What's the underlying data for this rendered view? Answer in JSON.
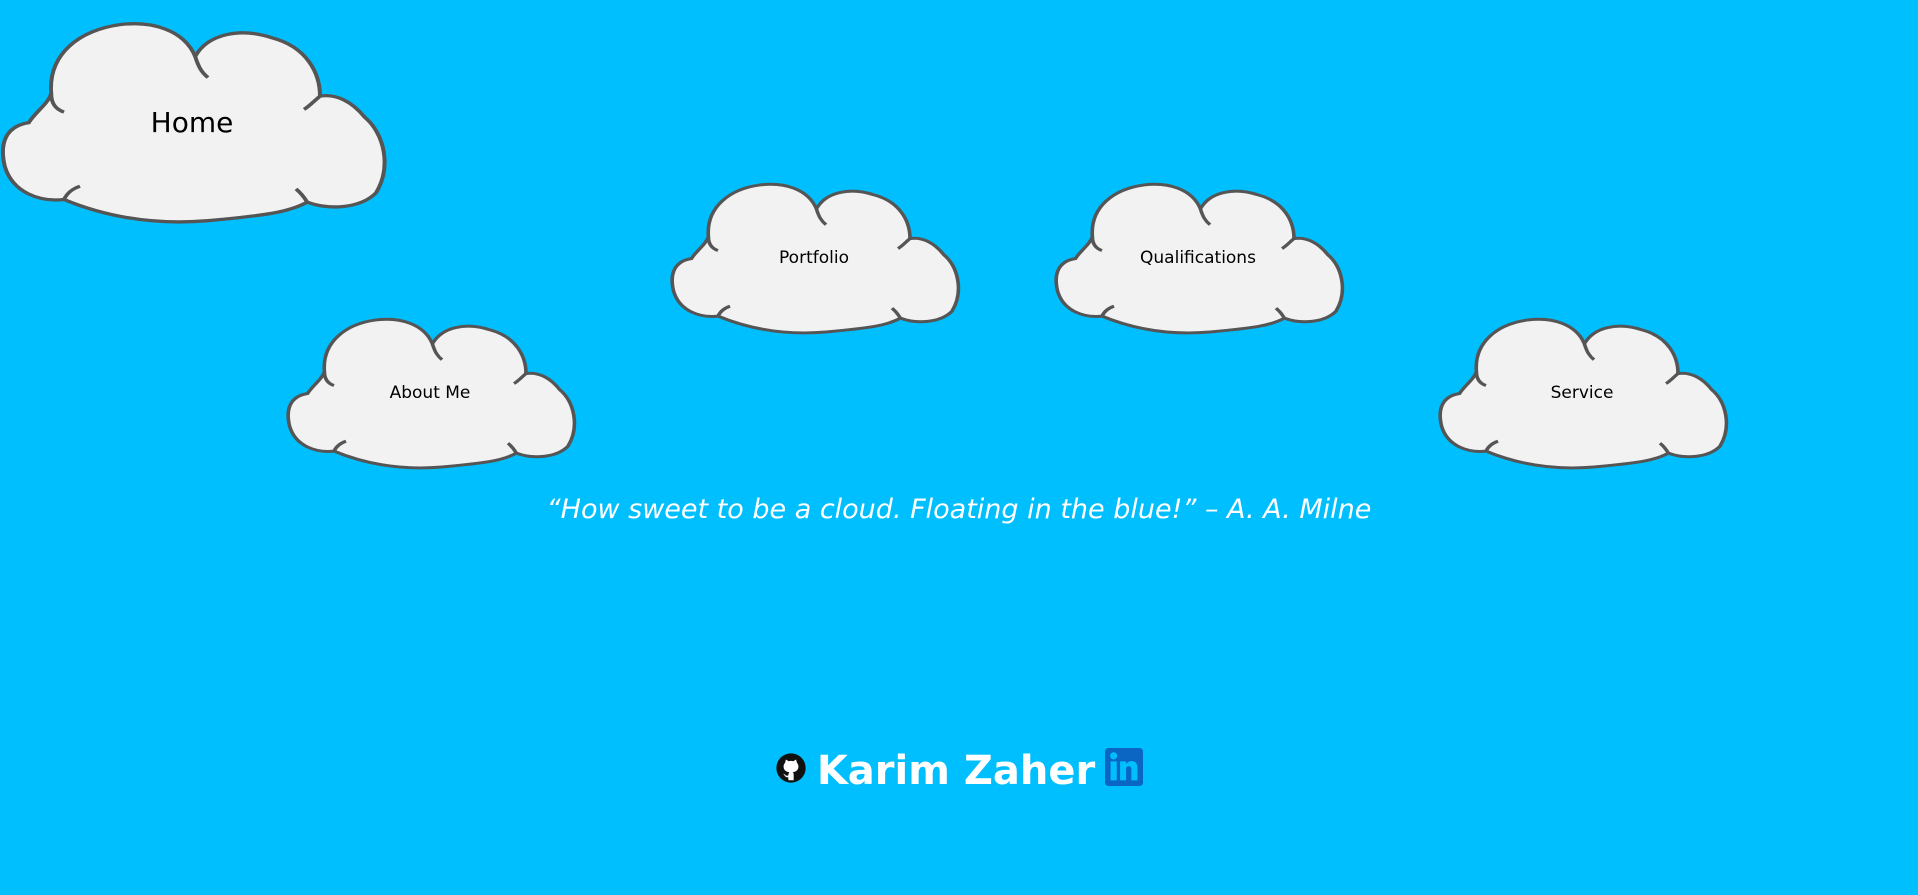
{
  "nav": {
    "home": "Home",
    "portfolio": "Portfolio",
    "qualifications": "Qualifications",
    "about": "About Me",
    "service": "Service"
  },
  "quote": "“How sweet to be a cloud. Floating in the blue!” – A. A. Milne",
  "footer": {
    "name": "Karim Zaher",
    "github_icon": "github-icon",
    "linkedin_icon": "linkedin-icon"
  },
  "colors": {
    "background": "#00bfff",
    "cloud_fill": "#f2f2f2",
    "cloud_stroke": "#555555",
    "linkedin": "#0a66c2"
  }
}
